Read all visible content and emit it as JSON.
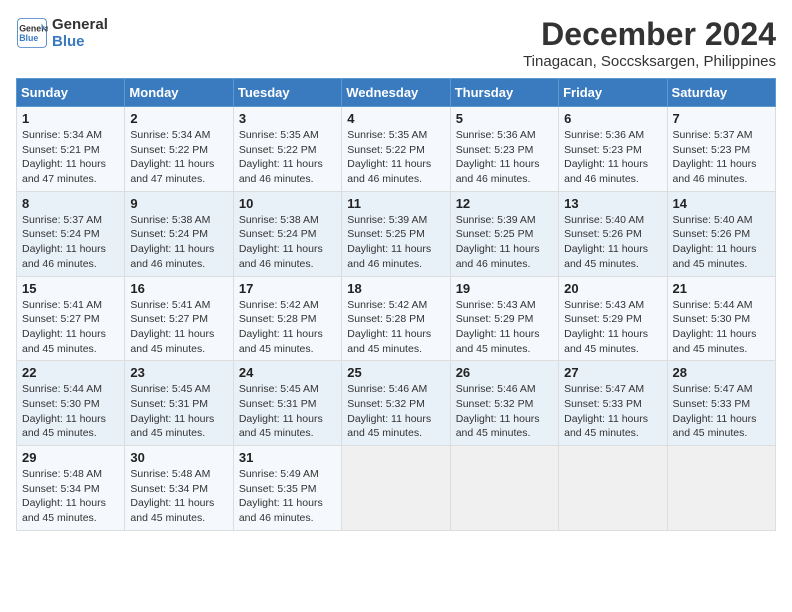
{
  "logo": {
    "line1": "General",
    "line2": "Blue"
  },
  "title": "December 2024",
  "subtitle": "Tinagacan, Soccsksargen, Philippines",
  "days_of_week": [
    "Sunday",
    "Monday",
    "Tuesday",
    "Wednesday",
    "Thursday",
    "Friday",
    "Saturday"
  ],
  "weeks": [
    [
      {
        "day": "1",
        "detail": "Sunrise: 5:34 AM\nSunset: 5:21 PM\nDaylight: 11 hours and 47 minutes."
      },
      {
        "day": "2",
        "detail": "Sunrise: 5:34 AM\nSunset: 5:22 PM\nDaylight: 11 hours and 47 minutes."
      },
      {
        "day": "3",
        "detail": "Sunrise: 5:35 AM\nSunset: 5:22 PM\nDaylight: 11 hours and 46 minutes."
      },
      {
        "day": "4",
        "detail": "Sunrise: 5:35 AM\nSunset: 5:22 PM\nDaylight: 11 hours and 46 minutes."
      },
      {
        "day": "5",
        "detail": "Sunrise: 5:36 AM\nSunset: 5:23 PM\nDaylight: 11 hours and 46 minutes."
      },
      {
        "day": "6",
        "detail": "Sunrise: 5:36 AM\nSunset: 5:23 PM\nDaylight: 11 hours and 46 minutes."
      },
      {
        "day": "7",
        "detail": "Sunrise: 5:37 AM\nSunset: 5:23 PM\nDaylight: 11 hours and 46 minutes."
      }
    ],
    [
      {
        "day": "8",
        "detail": "Sunrise: 5:37 AM\nSunset: 5:24 PM\nDaylight: 11 hours and 46 minutes."
      },
      {
        "day": "9",
        "detail": "Sunrise: 5:38 AM\nSunset: 5:24 PM\nDaylight: 11 hours and 46 minutes."
      },
      {
        "day": "10",
        "detail": "Sunrise: 5:38 AM\nSunset: 5:24 PM\nDaylight: 11 hours and 46 minutes."
      },
      {
        "day": "11",
        "detail": "Sunrise: 5:39 AM\nSunset: 5:25 PM\nDaylight: 11 hours and 46 minutes."
      },
      {
        "day": "12",
        "detail": "Sunrise: 5:39 AM\nSunset: 5:25 PM\nDaylight: 11 hours and 46 minutes."
      },
      {
        "day": "13",
        "detail": "Sunrise: 5:40 AM\nSunset: 5:26 PM\nDaylight: 11 hours and 45 minutes."
      },
      {
        "day": "14",
        "detail": "Sunrise: 5:40 AM\nSunset: 5:26 PM\nDaylight: 11 hours and 45 minutes."
      }
    ],
    [
      {
        "day": "15",
        "detail": "Sunrise: 5:41 AM\nSunset: 5:27 PM\nDaylight: 11 hours and 45 minutes."
      },
      {
        "day": "16",
        "detail": "Sunrise: 5:41 AM\nSunset: 5:27 PM\nDaylight: 11 hours and 45 minutes."
      },
      {
        "day": "17",
        "detail": "Sunrise: 5:42 AM\nSunset: 5:28 PM\nDaylight: 11 hours and 45 minutes."
      },
      {
        "day": "18",
        "detail": "Sunrise: 5:42 AM\nSunset: 5:28 PM\nDaylight: 11 hours and 45 minutes."
      },
      {
        "day": "19",
        "detail": "Sunrise: 5:43 AM\nSunset: 5:29 PM\nDaylight: 11 hours and 45 minutes."
      },
      {
        "day": "20",
        "detail": "Sunrise: 5:43 AM\nSunset: 5:29 PM\nDaylight: 11 hours and 45 minutes."
      },
      {
        "day": "21",
        "detail": "Sunrise: 5:44 AM\nSunset: 5:30 PM\nDaylight: 11 hours and 45 minutes."
      }
    ],
    [
      {
        "day": "22",
        "detail": "Sunrise: 5:44 AM\nSunset: 5:30 PM\nDaylight: 11 hours and 45 minutes."
      },
      {
        "day": "23",
        "detail": "Sunrise: 5:45 AM\nSunset: 5:31 PM\nDaylight: 11 hours and 45 minutes."
      },
      {
        "day": "24",
        "detail": "Sunrise: 5:45 AM\nSunset: 5:31 PM\nDaylight: 11 hours and 45 minutes."
      },
      {
        "day": "25",
        "detail": "Sunrise: 5:46 AM\nSunset: 5:32 PM\nDaylight: 11 hours and 45 minutes."
      },
      {
        "day": "26",
        "detail": "Sunrise: 5:46 AM\nSunset: 5:32 PM\nDaylight: 11 hours and 45 minutes."
      },
      {
        "day": "27",
        "detail": "Sunrise: 5:47 AM\nSunset: 5:33 PM\nDaylight: 11 hours and 45 minutes."
      },
      {
        "day": "28",
        "detail": "Sunrise: 5:47 AM\nSunset: 5:33 PM\nDaylight: 11 hours and 45 minutes."
      }
    ],
    [
      {
        "day": "29",
        "detail": "Sunrise: 5:48 AM\nSunset: 5:34 PM\nDaylight: 11 hours and 45 minutes."
      },
      {
        "day": "30",
        "detail": "Sunrise: 5:48 AM\nSunset: 5:34 PM\nDaylight: 11 hours and 45 minutes."
      },
      {
        "day": "31",
        "detail": "Sunrise: 5:49 AM\nSunset: 5:35 PM\nDaylight: 11 hours and 46 minutes."
      },
      null,
      null,
      null,
      null
    ]
  ]
}
